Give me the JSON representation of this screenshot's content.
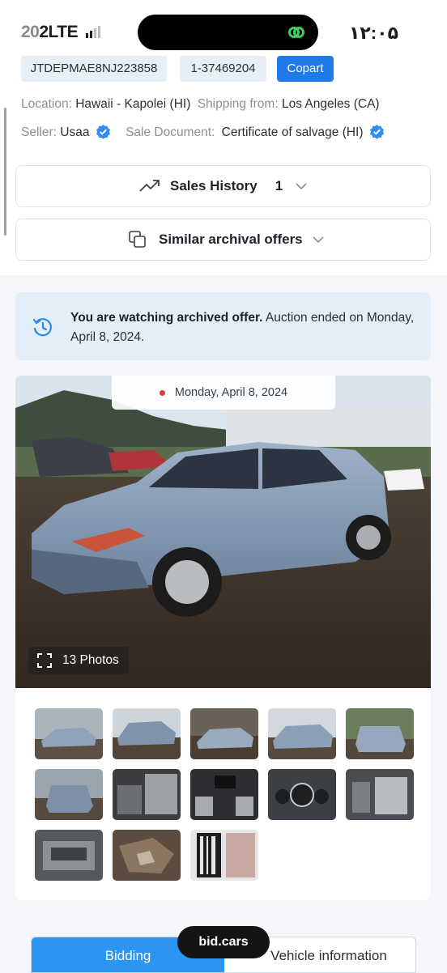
{
  "status_bar": {
    "left_text_faded": "20",
    "left_text": "2LTE",
    "right_text": "۱۲:۰۵"
  },
  "chips": {
    "vin": "JTDEPMAE8NJ223858",
    "lot": "1-37469204",
    "source": "Copart"
  },
  "info": {
    "location_label": "Location:",
    "location_value": "Hawaii - Kapolei (HI)",
    "shipping_label": "Shipping from:",
    "shipping_value": "Los Angeles (CA)",
    "seller_label": "Seller:",
    "seller_value": "Usaa",
    "document_label": "Sale Document:",
    "document_value": "Certificate of salvage (HI)"
  },
  "sales_history": {
    "label": "Sales History",
    "count": "1"
  },
  "similar_offers": {
    "label": "Similar archival offers"
  },
  "notice": {
    "bold": "You are watching archived offer.",
    "text": " Auction ended on Monday, April 8, 2024."
  },
  "gallery": {
    "date": "Monday, April 8, 2024",
    "photo_count": "13 Photos"
  },
  "tabs": {
    "bidding": "Bidding",
    "vehicle": "Vehicle information"
  },
  "brand": "bid.cars",
  "colors": {
    "accent": "#1f7ae8",
    "tab_active": "#2b95f0",
    "notice_bg": "#e4eef9",
    "verified": "#2f8cf0"
  }
}
